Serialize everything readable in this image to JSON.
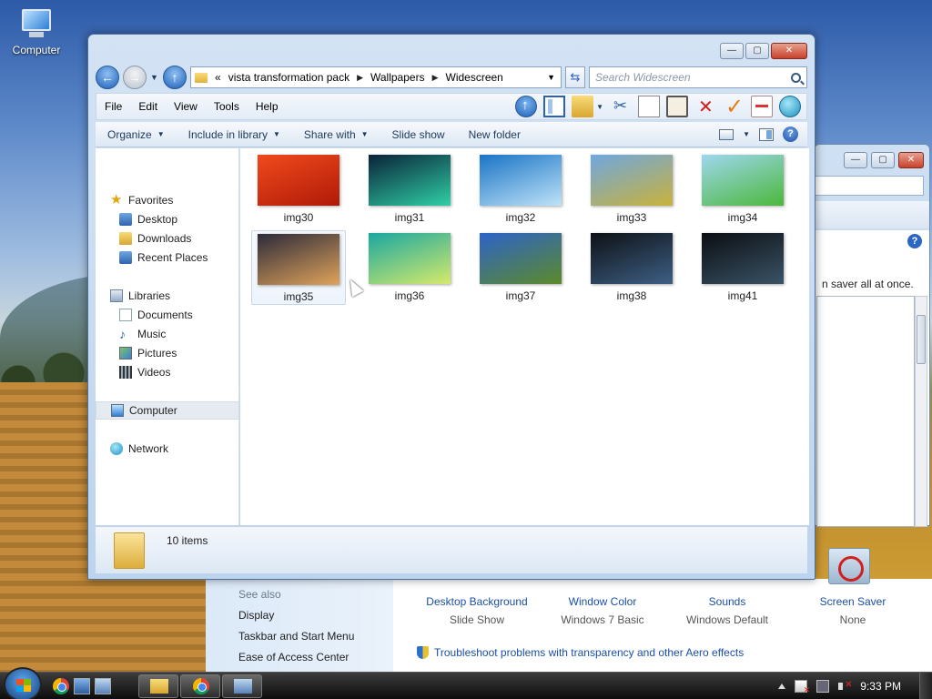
{
  "desktop": {
    "icon_label": "Computer"
  },
  "background_window": {
    "hint_text": "n saver all at once.",
    "help_label": "?",
    "see_also_header": "See also",
    "see_also_links": [
      "Display",
      "Taskbar and Start Menu",
      "Ease of Access Center"
    ],
    "items": [
      {
        "title": "Desktop Background",
        "subtitle": "Slide Show"
      },
      {
        "title": "Window Color",
        "subtitle": "Windows 7 Basic"
      },
      {
        "title": "Sounds",
        "subtitle": "Windows Default"
      },
      {
        "title": "Screen Saver",
        "subtitle": "None"
      }
    ],
    "troubleshoot_link": "Troubleshoot problems with transparency and other Aero effects"
  },
  "explorer": {
    "window_controls": {
      "minimize": "—",
      "maximize": "▢",
      "close": "✕"
    },
    "address": {
      "overflow": "«",
      "crumbs": [
        "vista transformation pack",
        "Wallpapers",
        "Widescreen"
      ]
    },
    "search_placeholder": "Search Widescreen",
    "menu": [
      "File",
      "Edit",
      "View",
      "Tools",
      "Help"
    ],
    "commands": [
      "Organize",
      "Include in library",
      "Share with",
      "Slide show",
      "New folder"
    ],
    "help_label": "?",
    "nav": {
      "favorites": "Favorites",
      "desktop": "Desktop",
      "downloads": "Downloads",
      "recent": "Recent Places",
      "libraries": "Libraries",
      "documents": "Documents",
      "music": "Music",
      "pictures": "Pictures",
      "videos": "Videos",
      "computer": "Computer",
      "network": "Network"
    },
    "files": [
      {
        "name": "img30",
        "colors": [
          "#f04a1c",
          "#b01a08"
        ]
      },
      {
        "name": "img31",
        "colors": [
          "#0a2238",
          "#2fd0a6"
        ]
      },
      {
        "name": "img32",
        "colors": [
          "#1a74c6",
          "#bfe3f8"
        ]
      },
      {
        "name": "img33",
        "colors": [
          "#6fa7e0",
          "#c9b23a"
        ]
      },
      {
        "name": "img34",
        "colors": [
          "#9fd7ef",
          "#4bb83a"
        ]
      },
      {
        "name": "img35",
        "colors": [
          "#2c2a3a",
          "#e0a35a"
        ]
      },
      {
        "name": "img36",
        "colors": [
          "#1aa7a1",
          "#d6ea6a"
        ]
      },
      {
        "name": "img37",
        "colors": [
          "#2d63c9",
          "#5c8a2a"
        ]
      },
      {
        "name": "img38",
        "colors": [
          "#0e1115",
          "#3d5f85"
        ]
      },
      {
        "name": "img41",
        "colors": [
          "#0b0e12",
          "#3a5366"
        ]
      }
    ],
    "status": {
      "item_count": "10 items"
    }
  },
  "taskbar": {
    "clock": "9:33 PM"
  }
}
